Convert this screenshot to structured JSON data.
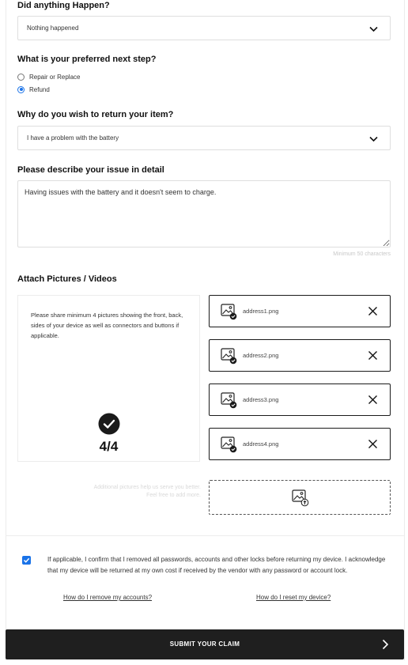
{
  "questions": {
    "happened": {
      "label": "Did anything Happen?",
      "value": "Nothing happened"
    },
    "next_step": {
      "label": "What is your preferred next step?",
      "options": [
        {
          "label": "Repair or Replace",
          "selected": false
        },
        {
          "label": "Refund",
          "selected": true
        }
      ]
    },
    "reason": {
      "label": "Why do you wish to return your item?",
      "value": "I have a problem with the battery"
    },
    "description": {
      "label": "Please describe your issue in detail",
      "value": "Having issues with the battery and it doesn't seem to charge.",
      "hint": "Minimum 50 characters"
    }
  },
  "attachments": {
    "label": "Attach Pictures / Videos",
    "instructions": "Please share minimum 4 pictures showing the front, back, sides of your device as well as connectors and buttons if applicable.",
    "counter": "4/4",
    "files": [
      "address1.png",
      "address2.png",
      "address3.png",
      "address4.png"
    ],
    "additional_note": "Additional pictures help us serve you better. Feel free to add more."
  },
  "confirmation": {
    "checked": true,
    "text": "If applicable, I confirm that I removed all passwords, accounts and other locks before returning my device. I acknowledge that my device will be returned at my own cost if received by the vendor with any password or account lock.",
    "link_accounts": "How do I remove my accounts?",
    "link_reset": "How do I reset my device?"
  },
  "submit": {
    "label": "SUBMIT YOUR CLAIM"
  },
  "colors": {
    "accent": "#1a73e8",
    "button_bg": "#1f1f1f"
  }
}
